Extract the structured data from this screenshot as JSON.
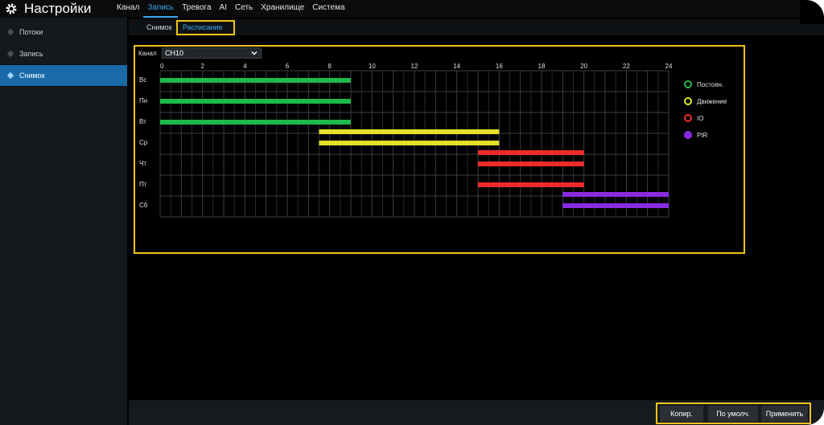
{
  "app": {
    "title": "Настройки"
  },
  "nav": {
    "items": [
      "Канал",
      "Запись",
      "Тревога",
      "AI",
      "Сеть",
      "Хранилище",
      "Система"
    ],
    "active": "Запись"
  },
  "sidebar": {
    "items": [
      {
        "label": "Потоки"
      },
      {
        "label": "Запись"
      },
      {
        "label": "Снимок"
      }
    ],
    "active": "Снимок"
  },
  "subtabs": {
    "items": [
      "Снимок",
      "Расписание"
    ],
    "active": "Расписание"
  },
  "channel": {
    "label": "Канал",
    "value": "CH10"
  },
  "schedule": {
    "hour_labels": [
      "0",
      "2",
      "4",
      "6",
      "8",
      "10",
      "12",
      "14",
      "16",
      "18",
      "20",
      "22",
      "24"
    ],
    "days": [
      "Вс",
      "Пн",
      "Вт",
      "Ср",
      "Чт",
      "Пт",
      "Сб"
    ],
    "segments": [
      {
        "day": 0,
        "start": 0,
        "end": 9,
        "mode": "Постоян."
      },
      {
        "day": 1,
        "start": 0,
        "end": 9,
        "mode": "Постоян."
      },
      {
        "day": 2,
        "start": 0,
        "end": 9,
        "mode": "Постоян."
      },
      {
        "day": 2,
        "start": 7.5,
        "end": 16,
        "mode": "Движение"
      },
      {
        "day": 3,
        "start": 7.5,
        "end": 16,
        "mode": "Движение"
      },
      {
        "day": 3,
        "start": 15,
        "end": 20,
        "mode": "IO"
      },
      {
        "day": 4,
        "start": 15,
        "end": 20,
        "mode": "IO"
      },
      {
        "day": 5,
        "start": 15,
        "end": 20,
        "mode": "IO"
      },
      {
        "day": 5,
        "start": 19,
        "end": 24,
        "mode": "PIR"
      },
      {
        "day": 6,
        "start": 19,
        "end": 24,
        "mode": "PIR"
      }
    ]
  },
  "legend": [
    {
      "label": "Постоян.",
      "color": "#1fb84a"
    },
    {
      "label": "Движение",
      "color": "#e3e02a"
    },
    {
      "label": "IO",
      "color": "#ee2b2b"
    },
    {
      "label": "PIR",
      "color": "#8a2be2"
    }
  ],
  "buttons": {
    "copy": "Копир.",
    "default": "По умолч.",
    "apply": "Применить"
  },
  "colors": {
    "accent": "#3aa8f0",
    "highlight": "#f1c21b"
  }
}
